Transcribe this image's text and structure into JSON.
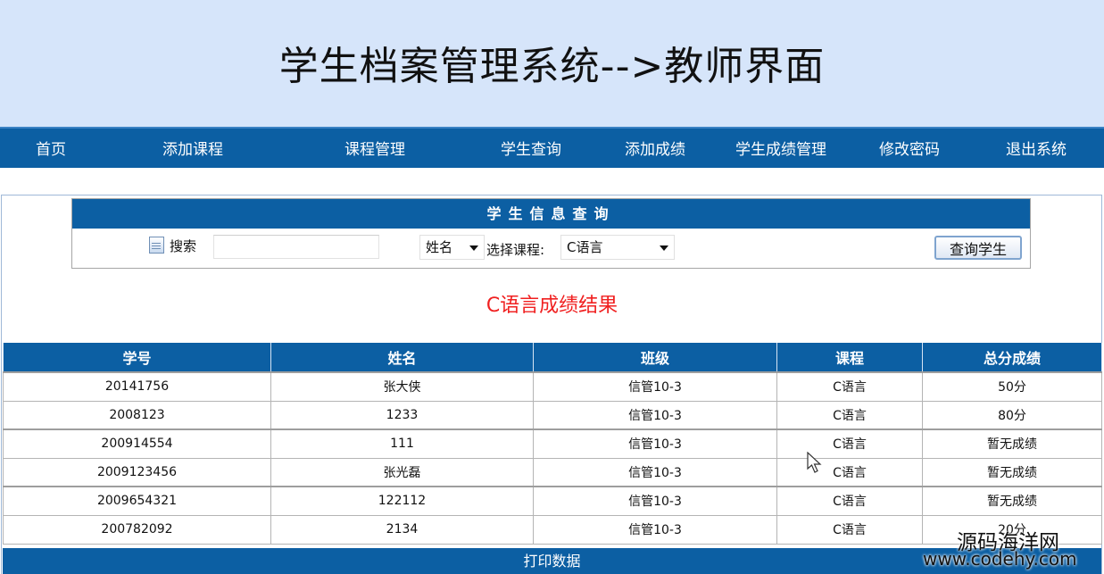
{
  "header": {
    "title": "学生档案管理系统-->教师界面"
  },
  "nav": {
    "items": [
      "首页",
      "添加课程",
      "课程管理",
      "学生查询",
      "添加成绩",
      "学生成绩管理",
      "修改密码",
      "退出系统"
    ]
  },
  "search_panel": {
    "title": "学生信息查询",
    "search_label": "搜索",
    "search_value": "",
    "field_select": "姓名",
    "course_label": "选择课程:",
    "course_select": "C语言",
    "query_button": "查询学生"
  },
  "result": {
    "title": "C语言成绩结果",
    "columns": [
      "学号",
      "姓名",
      "班级",
      "课程",
      "总分成绩"
    ],
    "rows": [
      [
        "20141756",
        "张大侠",
        "信管10-3",
        "C语言",
        "50分"
      ],
      [
        "2008123",
        "1233",
        "信管10-3",
        "C语言",
        "80分"
      ],
      [
        "200914554",
        "111",
        "信管10-3",
        "C语言",
        "暂无成绩"
      ],
      [
        "2009123456",
        "张光磊",
        "信管10-3",
        "C语言",
        "暂无成绩"
      ],
      [
        "2009654321",
        "122112",
        "信管10-3",
        "C语言",
        "暂无成绩"
      ],
      [
        "200782092",
        "2134",
        "信管10-3",
        "C语言",
        "20分"
      ]
    ]
  },
  "print_button": "打印数据",
  "watermark": {
    "line1": "源码海洋网",
    "line2": "www.codehy.com"
  },
  "colors": {
    "nav_bg": "#0c5fa3",
    "header_bg": "#d6e5fa",
    "result_title": "#f02020"
  }
}
